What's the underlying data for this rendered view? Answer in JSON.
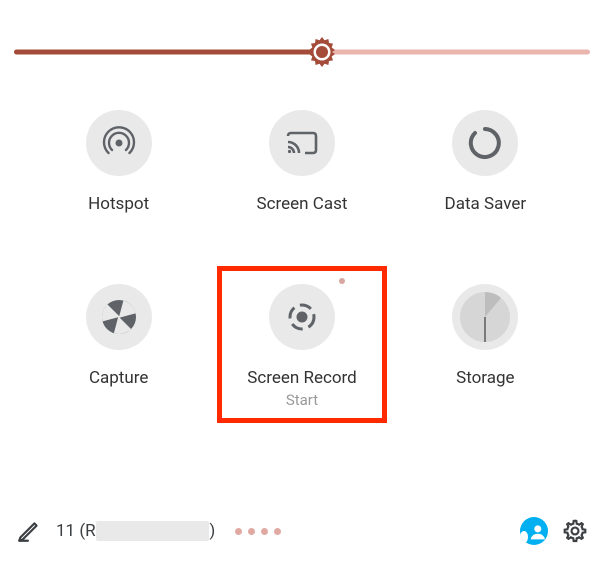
{
  "slider": {
    "value_pct": 53.5
  },
  "tiles": {
    "hotspot": {
      "label": "Hotspot"
    },
    "screen_cast": {
      "label": "Screen Cast"
    },
    "data_saver": {
      "label": "Data Saver"
    },
    "capture": {
      "label": "Capture"
    },
    "screen_record": {
      "label": "Screen Record",
      "sub": "Start",
      "highlighted": true
    },
    "storage": {
      "label": "Storage"
    }
  },
  "bottom": {
    "version_text": "11 (R",
    "version_tail": ")",
    "page_dots": 4
  },
  "icons": {
    "hotspot": "hotspot-icon",
    "cast": "cast-icon",
    "data_saver": "data-saver-icon",
    "capture": "aperture-icon",
    "record": "record-icon",
    "storage": "storage-icon",
    "brightness": "brightness-icon",
    "edit": "pencil-icon",
    "account": "account-icon",
    "settings": "gear-icon"
  }
}
